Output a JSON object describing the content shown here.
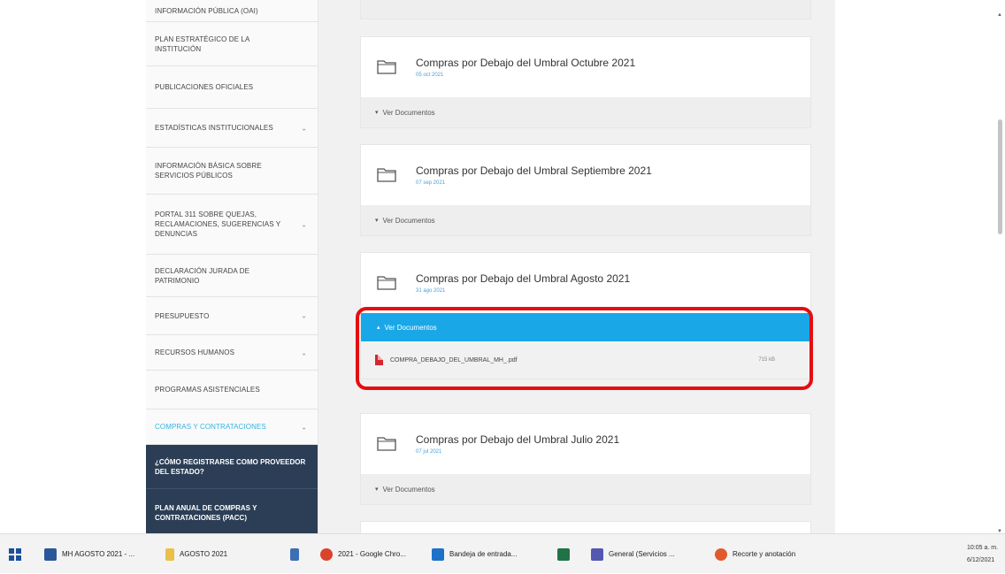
{
  "sidebar": {
    "items": [
      {
        "label": "INFORMACIÓN PÚBLICA (OAI)",
        "chevron": false
      },
      {
        "label": "PLAN ESTRATÉGICO DE LA INSTITUCIÓN",
        "chevron": false
      },
      {
        "label": "PUBLICACIONES OFICIALES",
        "chevron": false
      },
      {
        "label": "ESTADÍSTICAS INSTITUCIONALES",
        "chevron": true
      },
      {
        "label": "INFORMACIÓN BÁSICA SOBRE SERVICIOS PÚBLICOS",
        "chevron": false
      },
      {
        "label": "PORTAL 311 SOBRE QUEJAS, RECLAMACIONES, SUGERENCIAS Y DENUNCIAS",
        "chevron": true
      },
      {
        "label": "DECLARACIÓN JURADA DE PATRIMONIO",
        "chevron": false
      },
      {
        "label": "PRESUPUESTO",
        "chevron": true
      },
      {
        "label": "RECURSOS HUMANOS",
        "chevron": true
      },
      {
        "label": "PROGRAMAS ASISTENCIALES",
        "chevron": false
      },
      {
        "label": "COMPRAS Y CONTRATACIONES",
        "chevron": true,
        "active": true
      }
    ],
    "subitems": [
      {
        "label": "¿CÓMO REGISTRARSE COMO PROVEEDOR DEL ESTADO?"
      },
      {
        "label": "PLAN ANUAL DE COMPRAS Y CONTRATACIONES (PACC)"
      }
    ],
    "chevron_glyph": "⌄"
  },
  "cards": [
    {
      "title": "Compras por Debajo del Umbral Octubre 2021",
      "date": "05 oct 2021",
      "toggle": "Ver Documentos"
    },
    {
      "title": "Compras por Debajo del Umbral Septiembre 2021",
      "date": "07 sep 2021",
      "toggle": "Ver Documentos"
    },
    {
      "title": "Compras por Debajo del Umbral Agosto 2021",
      "date": "31 ago 2021",
      "toggle": "Ver Documentos",
      "file": {
        "name": "COMPRA_DEBAJO_DEL_UMBRAL_MH_.pdf",
        "size": "715 kB"
      }
    },
    {
      "title": "Compras por Debajo del Umbral Julio 2021",
      "date": "07 jul 2021",
      "toggle": "Ver Documentos"
    }
  ],
  "taskbar": {
    "items": [
      {
        "label": "",
        "icon": "windows-start-icon",
        "color": "#1a4f9c"
      },
      {
        "label": "MH AGOSTO 2021 - ...",
        "icon": "word-icon",
        "color": "#2b579a"
      },
      {
        "label": "AGOSTO 2021",
        "icon": "folder-icon",
        "color": "#e8c04a"
      },
      {
        "label": "",
        "icon": "notepad-icon",
        "color": "#3d6fb5"
      },
      {
        "label": "2021 - Google Chro...",
        "icon": "chrome-icon",
        "color": "#d9442d"
      },
      {
        "label": "Bandeja de entrada...",
        "icon": "outlook-icon",
        "color": "#1c71c8"
      },
      {
        "label": "",
        "icon": "excel-icon",
        "color": "#217346"
      },
      {
        "label": "General (Servicios ...",
        "icon": "teams-icon",
        "color": "#5458b0"
      },
      {
        "label": "Recorte y anotación",
        "icon": "snip-icon",
        "color": "#e05b2c"
      }
    ],
    "time": "10:05 a. m.",
    "date": "6/12/2021"
  },
  "colors": {
    "accent": "#1aa7e7",
    "highlight": "#e30f12",
    "sidebar_dark": "#2b3e55"
  }
}
